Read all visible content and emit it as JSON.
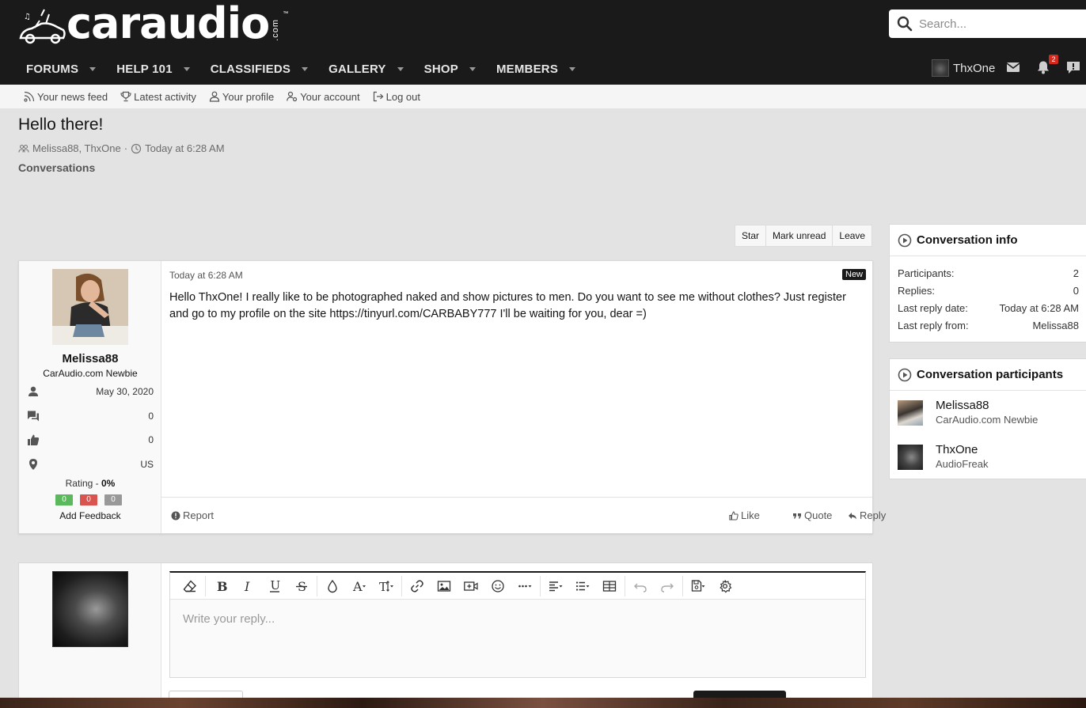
{
  "header": {
    "logo_text": "caraudio",
    "logo_suffix": ".com",
    "logo_tm": "™",
    "search_placeholder": "Search...",
    "nav": [
      {
        "label": "FORUMS"
      },
      {
        "label": "HELP 101"
      },
      {
        "label": "CLASSIFIEDS"
      },
      {
        "label": "GALLERY"
      },
      {
        "label": "SHOP"
      },
      {
        "label": "MEMBERS"
      }
    ],
    "username": "ThxOne",
    "alerts_count": "2"
  },
  "subnav": {
    "items": [
      {
        "label": "Your news feed",
        "icon": "rss-icon"
      },
      {
        "label": "Latest activity",
        "icon": "trophy-icon"
      },
      {
        "label": "Your profile",
        "icon": "user-icon"
      },
      {
        "label": "Your account",
        "icon": "user-gear-icon"
      },
      {
        "label": "Log out",
        "icon": "logout-icon"
      }
    ]
  },
  "page": {
    "title": "Hello there!",
    "participants": "Melissa88, ThxOne",
    "separator": "·",
    "date": "Today at 6:28 AM",
    "breadcrumb": "Conversations"
  },
  "actions": {
    "star": "Star",
    "mark_unread": "Mark unread",
    "leave": "Leave"
  },
  "message": {
    "author": "Melissa88",
    "author_title": "CarAudio.com Newbie",
    "joined": "May 30, 2020",
    "messages": "0",
    "likes": "0",
    "location": "US",
    "rating_label": "Rating - ",
    "rating_value": "0%",
    "feedback": {
      "positive": "0",
      "negative": "0",
      "neutral": "0"
    },
    "add_feedback": "Add Feedback",
    "date": "Today at 6:28 AM",
    "new_label": "New",
    "body": "Hello ThxOne! I really like to be photographed naked and show pictures to men. Do you want to see me without clothes? Just register and go to my profile on the site https://tinyurl.com/CARBABY777 I'll be waiting for you, dear =)",
    "report": "Report",
    "like": "Like",
    "quote": "Quote",
    "reply": "Reply"
  },
  "reply_box": {
    "placeholder": "Write your reply..."
  },
  "sidebar": {
    "info_title": "Conversation info",
    "info": [
      {
        "label": "Participants:",
        "value": "2"
      },
      {
        "label": "Replies:",
        "value": "0"
      },
      {
        "label": "Last reply date:",
        "value": "Today at 6:28 AM"
      },
      {
        "label": "Last reply from:",
        "value": "Melissa88"
      }
    ],
    "participants_title": "Conversation participants",
    "participants": [
      {
        "name": "Melissa88",
        "title": "CarAudio.com Newbie"
      },
      {
        "name": "ThxOne",
        "title": "AudioFreak"
      }
    ]
  },
  "colors": {
    "header_bg": "#1a1a1a",
    "page_bg": "#e3e3e3",
    "feedback_positive": "#5cb85c",
    "feedback_negative": "#d9534f",
    "feedback_neutral": "#999999",
    "alert_badge": "#d42a1e"
  }
}
